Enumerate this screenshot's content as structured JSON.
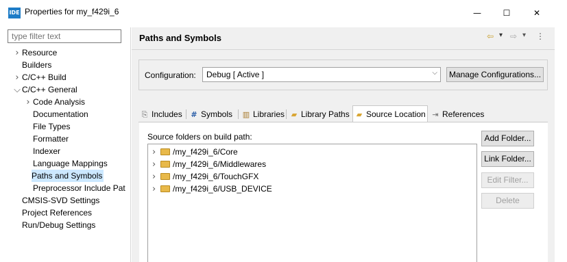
{
  "window": {
    "title": "Properties for my_f429i_6",
    "app_icon_label": "IDE",
    "minimize_glyph": "—",
    "maximize_glyph": "☐",
    "close_glyph": "✕"
  },
  "sidebar": {
    "filter_placeholder": "type filter text",
    "items": [
      {
        "label": "Resource",
        "level": 0,
        "twisty": ">",
        "selected": false
      },
      {
        "label": "Builders",
        "level": 0,
        "twisty": "",
        "selected": false
      },
      {
        "label": "C/C++ Build",
        "level": 0,
        "twisty": ">",
        "selected": false
      },
      {
        "label": "C/C++ General",
        "level": 0,
        "twisty": "v",
        "selected": false
      },
      {
        "label": "Code Analysis",
        "level": 1,
        "twisty": ">",
        "selected": false
      },
      {
        "label": "Documentation",
        "level": 1,
        "twisty": "",
        "selected": false
      },
      {
        "label": "File Types",
        "level": 1,
        "twisty": "",
        "selected": false
      },
      {
        "label": "Formatter",
        "level": 1,
        "twisty": "",
        "selected": false
      },
      {
        "label": "Indexer",
        "level": 1,
        "twisty": "",
        "selected": false
      },
      {
        "label": "Language Mappings",
        "level": 1,
        "twisty": "",
        "selected": false
      },
      {
        "label": "Paths and Symbols",
        "level": 1,
        "twisty": "",
        "selected": true
      },
      {
        "label": "Preprocessor Include Pat",
        "level": 1,
        "twisty": "",
        "selected": false
      },
      {
        "label": "CMSIS-SVD Settings",
        "level": 0,
        "twisty": "",
        "selected": false
      },
      {
        "label": "Project References",
        "level": 0,
        "twisty": "",
        "selected": false
      },
      {
        "label": "Run/Debug Settings",
        "level": 0,
        "twisty": "",
        "selected": false
      }
    ]
  },
  "main": {
    "title": "Paths and Symbols",
    "nav": {
      "back_glyph": "⇦",
      "forward_glyph": "⇨",
      "dropdown_glyph": "▾",
      "menu_glyph": "⋮"
    },
    "configuration": {
      "label": "Configuration:",
      "value": "Debug  [ Active ]",
      "manage_button": "Manage Configurations..."
    },
    "tabs": [
      {
        "label": "Includes",
        "icon": "includes-icon",
        "glyph": "⎘",
        "active": false
      },
      {
        "label": "Symbols",
        "icon": "hash-icon",
        "glyph": "#",
        "active": false
      },
      {
        "label": "Libraries",
        "icon": "libraries-icon",
        "glyph": "▥",
        "active": false
      },
      {
        "label": "Library Paths",
        "icon": "folder-path-icon",
        "glyph": "▰",
        "active": false
      },
      {
        "label": "Source Location",
        "icon": "source-folder-icon",
        "glyph": "▰",
        "active": true
      },
      {
        "label": "References",
        "icon": "references-icon",
        "glyph": "⇥",
        "active": false
      }
    ],
    "source_folders_label": "Source folders on build path:",
    "folders": [
      "/my_f429i_6/Core",
      "/my_f429i_6/Middlewares",
      "/my_f429i_6/TouchGFX",
      "/my_f429i_6/USB_DEVICE"
    ],
    "buttons": [
      {
        "label": "Add Folder...",
        "enabled": true
      },
      {
        "label": "Link Folder...",
        "enabled": true
      },
      {
        "label": "Edit Filter...",
        "enabled": false
      },
      {
        "label": "Delete",
        "enabled": false
      }
    ]
  },
  "colors": {
    "selection": "#cce8ff",
    "panel": "#f0f0f0",
    "folder": "#e8b94a",
    "accent": "#1d7cc7"
  }
}
